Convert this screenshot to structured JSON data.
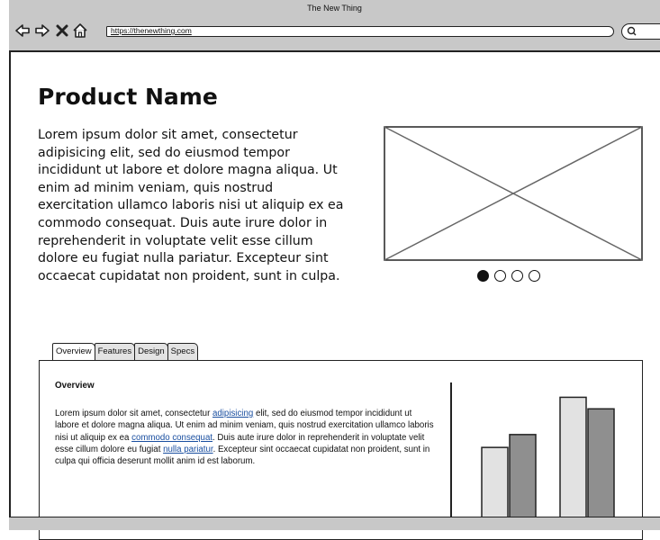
{
  "window": {
    "title": "The New Thing",
    "address": "https://thenewthing.com"
  },
  "icons": {
    "back": "arrow-left-icon",
    "forward": "arrow-right-icon",
    "stop": "close-icon",
    "home": "home-icon",
    "search": "search-icon"
  },
  "product": {
    "name": "Product Name",
    "description": "Lorem ipsum dolor sit amet, consectetur adipisicing elit, sed do eiusmod tempor incididunt ut labore et dolore magna aliqua. Ut enim ad minim veniam, quis nostrud exercitation ullamco laboris nisi ut aliquip ex ea commodo consequat. Duis aute irure dolor in reprehenderit in voluptate velit esse cillum dolore eu fugiat nulla pariatur. Excepteur sint occaecat cupidatat non proident, sunt in culpa."
  },
  "carousel": {
    "total": 4,
    "active_index": 0
  },
  "tabs": [
    {
      "label": "Overview",
      "active": true
    },
    {
      "label": "Features",
      "active": false
    },
    {
      "label": "Design",
      "active": false
    },
    {
      "label": "Specs",
      "active": false
    }
  ],
  "overview": {
    "heading": "Overview",
    "text_1": "Lorem ipsum dolor sit amet, consectetur ",
    "link_1": "adipisicing",
    "text_2": " elit, sed do eiusmod tempor incididunt ut labore et dolore magna aliqua. Ut enim ad minim veniam, quis nostrud exercitation ullamco laboris nisi ut aliquip ex ea ",
    "link_2": "commodo consequat",
    "text_3": ". Duis aute irure dolor in reprehenderit in voluptate velit esse cillum dolore eu fugiat ",
    "link_3": "nulla pariatur",
    "text_4": ". Excepteur sint occaecat cupidatat non proident, sunt in culpa qui officia deserunt mollit anim id est laborum."
  },
  "colors": {
    "chrome": "#c8c8c8",
    "link": "#1a4fa0",
    "bar_light": "#e2e2e2",
    "bar_dark": "#8f8f8f"
  },
  "chart_data": {
    "type": "bar",
    "categories": [
      "",
      ""
    ],
    "series": [
      {
        "values": [
          58,
          97
        ]
      },
      {
        "values": [
          68,
          88
        ]
      }
    ],
    "ylim": [
      0,
      105
    ]
  }
}
